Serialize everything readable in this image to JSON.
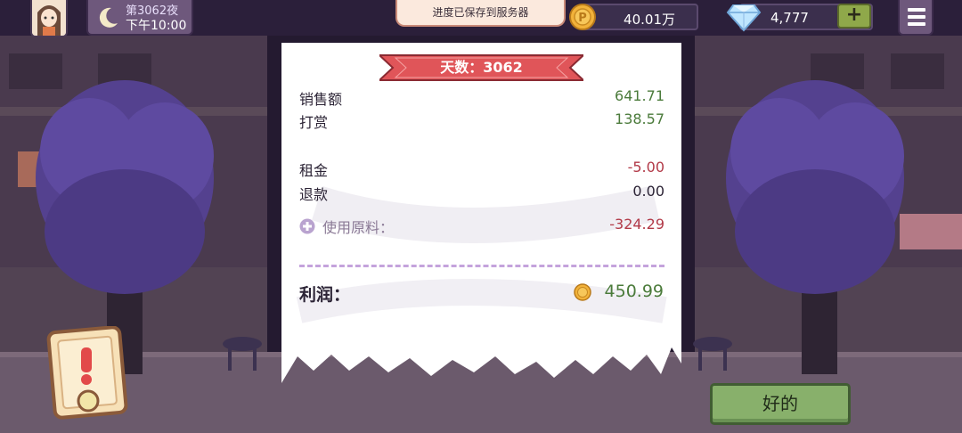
{
  "hud": {
    "night_label": "第3062夜",
    "time": "下午10:00",
    "toast": "进度已保存到服务器",
    "coins": "40.01万",
    "gems": "4,777",
    "plus": "+"
  },
  "receipt": {
    "banner": "天数：3062",
    "sales_label": "销售额",
    "sales_value": "641.71",
    "tips_label": "打赏",
    "tips_value": "138.57",
    "rent_label": "租金",
    "rent_value": "-5.00",
    "refund_label": "退款",
    "refund_value": "0.00",
    "materials_label": "使用原料：",
    "materials_value": "-324.29",
    "profit_label": "利润：",
    "profit_value": "450.99"
  },
  "buttons": {
    "ok": "好的"
  },
  "colors": {
    "positive": "#4b7b3b",
    "negative": "#b23a48",
    "banner": "#e05559",
    "ok_button": "#88b06b"
  },
  "icons": [
    "moon-icon",
    "coin-icon",
    "diamond-icon",
    "menu-icon",
    "plus-circle-icon",
    "alert-icon"
  ]
}
